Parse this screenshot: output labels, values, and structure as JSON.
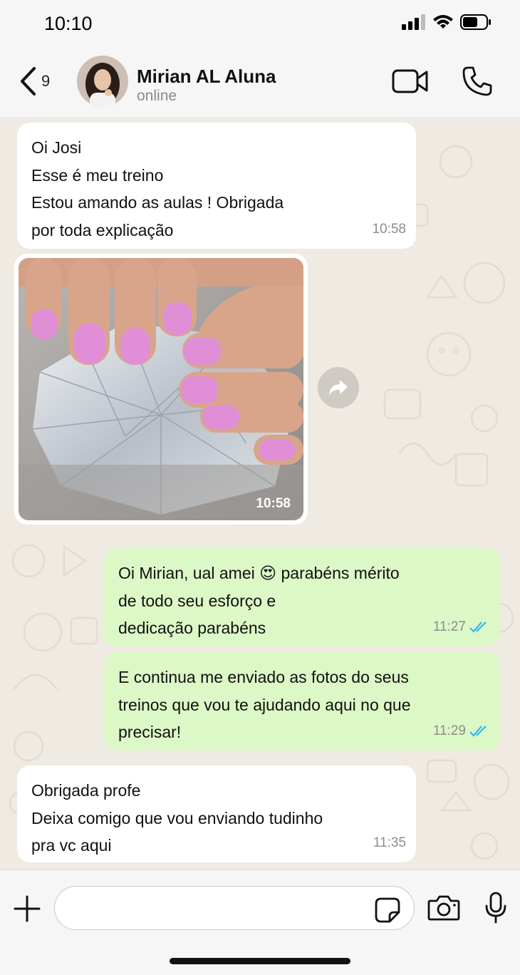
{
  "status_bar": {
    "time": "10:10"
  },
  "header": {
    "back_count": "9",
    "contact_name": "Mirian AL Aluna",
    "contact_status": "online"
  },
  "messages": [
    {
      "direction": "in",
      "lines": [
        "Oi Josi",
        "Esse é meu treino",
        "Estou amando as aulas ! Obrigada",
        "por toda explicação"
      ],
      "time": "10:58"
    },
    {
      "direction": "in",
      "type": "image",
      "time": "10:58"
    },
    {
      "direction": "out",
      "lines": [
        "Oi Mirian, ual amei 😍 parabéns mérito",
        "de todo seu esforço e",
        "dedicação parabéns"
      ],
      "time": "11:27",
      "read": true
    },
    {
      "direction": "out",
      "lines": [
        "E continua me enviado as fotos do seus",
        "treinos que vou te ajudando aqui no que",
        "precisar!"
      ],
      "time": "11:29",
      "read": true
    },
    {
      "direction": "in",
      "lines": [
        "Obrigada profe",
        "Deixa comigo que vou enviando tudinho",
        "pra vc aqui"
      ],
      "time": "11:35"
    }
  ],
  "colors": {
    "incoming_bubble": "#ffffff",
    "outgoing_bubble": "#dcf8c6",
    "read_ticks": "#34b7f1",
    "chat_background": "#efeae2"
  },
  "icons": [
    "back-chevron-icon",
    "video-call-icon",
    "phone-icon",
    "forward-icon",
    "plus-icon",
    "sticker-icon",
    "camera-icon",
    "mic-icon",
    "read-receipt-icon",
    "signal-icon",
    "wifi-icon",
    "battery-icon"
  ],
  "composer": {
    "value": "",
    "placeholder": ""
  }
}
